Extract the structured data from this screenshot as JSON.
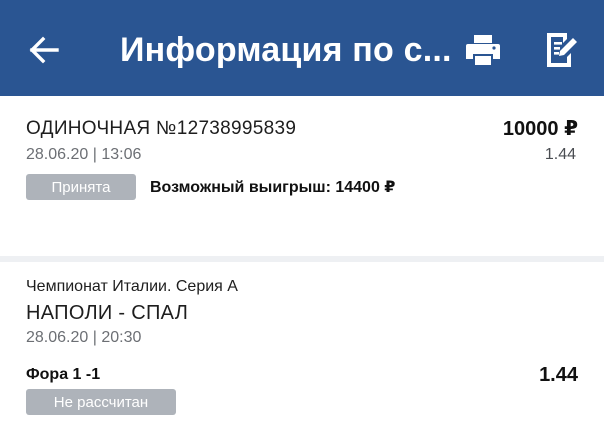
{
  "header": {
    "title": "Информация по с...",
    "back_icon": "arrow-left-icon",
    "print_icon": "printer-icon",
    "edit_icon": "edit-note-icon",
    "background": "#2a5592"
  },
  "bet": {
    "type_and_number": "ОДИНОЧНАЯ №12738995839",
    "amount": "10000 ₽",
    "datetime": "28.06.20 | 13:06",
    "coefficient": "1.44",
    "status": "Принята",
    "possible_win": "Возможный выигрыш: 14400 ₽"
  },
  "event": {
    "league": "Чемпионат Италии. Серия А",
    "match": "НАПОЛИ - СПАЛ",
    "datetime": "28.06.20 | 20:30",
    "market": "Фора 1 -1",
    "coefficient": "1.44",
    "status": "Не рассчитан"
  }
}
